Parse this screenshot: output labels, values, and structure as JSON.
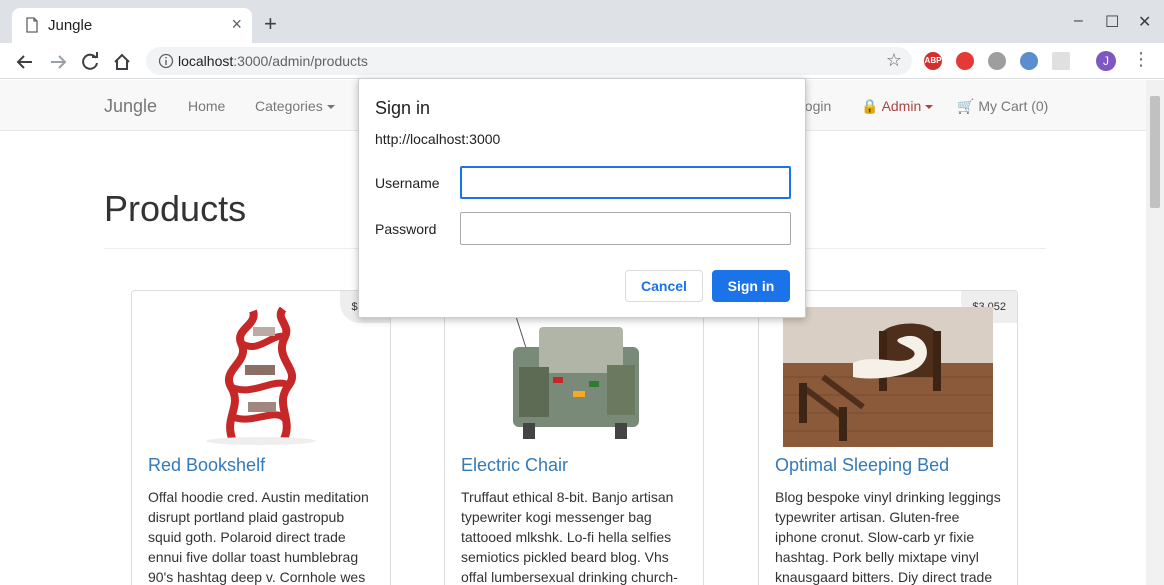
{
  "browser": {
    "tab_title": "Jungle",
    "tab_close": "×",
    "new_tab": "+",
    "window_controls": [
      "–",
      "☐",
      "✕"
    ],
    "url_host": "localhost",
    "url_rest": ":3000/admin/products",
    "extensions": [
      {
        "name": "abp-icon",
        "label": "ABP",
        "color": "#d32f2f"
      },
      {
        "name": "shield-icon",
        "label": "",
        "color": "#e53935"
      },
      {
        "name": "eye-icon",
        "label": "",
        "color": "#9e9e9e"
      },
      {
        "name": "pen-icon",
        "label": "",
        "color": "#5c8dcf"
      },
      {
        "name": "grid-icon",
        "label": "",
        "color": "#e0e0e0"
      }
    ],
    "avatar": "J"
  },
  "navbar": {
    "brand": "Jungle",
    "home": "Home",
    "categories": "Categories",
    "login": "Login",
    "admin": "Admin",
    "cart": "My Cart (0)"
  },
  "page": {
    "title": "Products"
  },
  "products": [
    {
      "name": "Red Bookshelf",
      "price": "$2,48",
      "desc": "Offal hoodie cred. Austin meditation disrupt portland plaid gastropub squid goth. Polaroid direct trade ennui five dollar toast humblebrag 90's hashtag deep v. Cornhole wes"
    },
    {
      "name": "Electric Chair",
      "price": "",
      "desc": "Truffaut ethical 8-bit. Banjo artisan typewriter kogi messenger bag tattooed mlkshk. Lo-fi hella selfies semiotics pickled beard blog. Vhs offal lumbersexual drinking church-"
    },
    {
      "name": "Optimal Sleeping Bed",
      "price": "$3,052",
      "desc": "Blog bespoke vinyl drinking leggings typewriter artisan. Gluten-free iphone cronut. Slow-carb yr fixie hashtag. Pork belly mixtape vinyl knausgaard bitters. Diy direct trade"
    }
  ],
  "dialog": {
    "title": "Sign in",
    "origin": "http://localhost:3000",
    "username_label": "Username",
    "username_value": "",
    "password_label": "Password",
    "password_value": "",
    "cancel": "Cancel",
    "submit": "Sign in"
  }
}
